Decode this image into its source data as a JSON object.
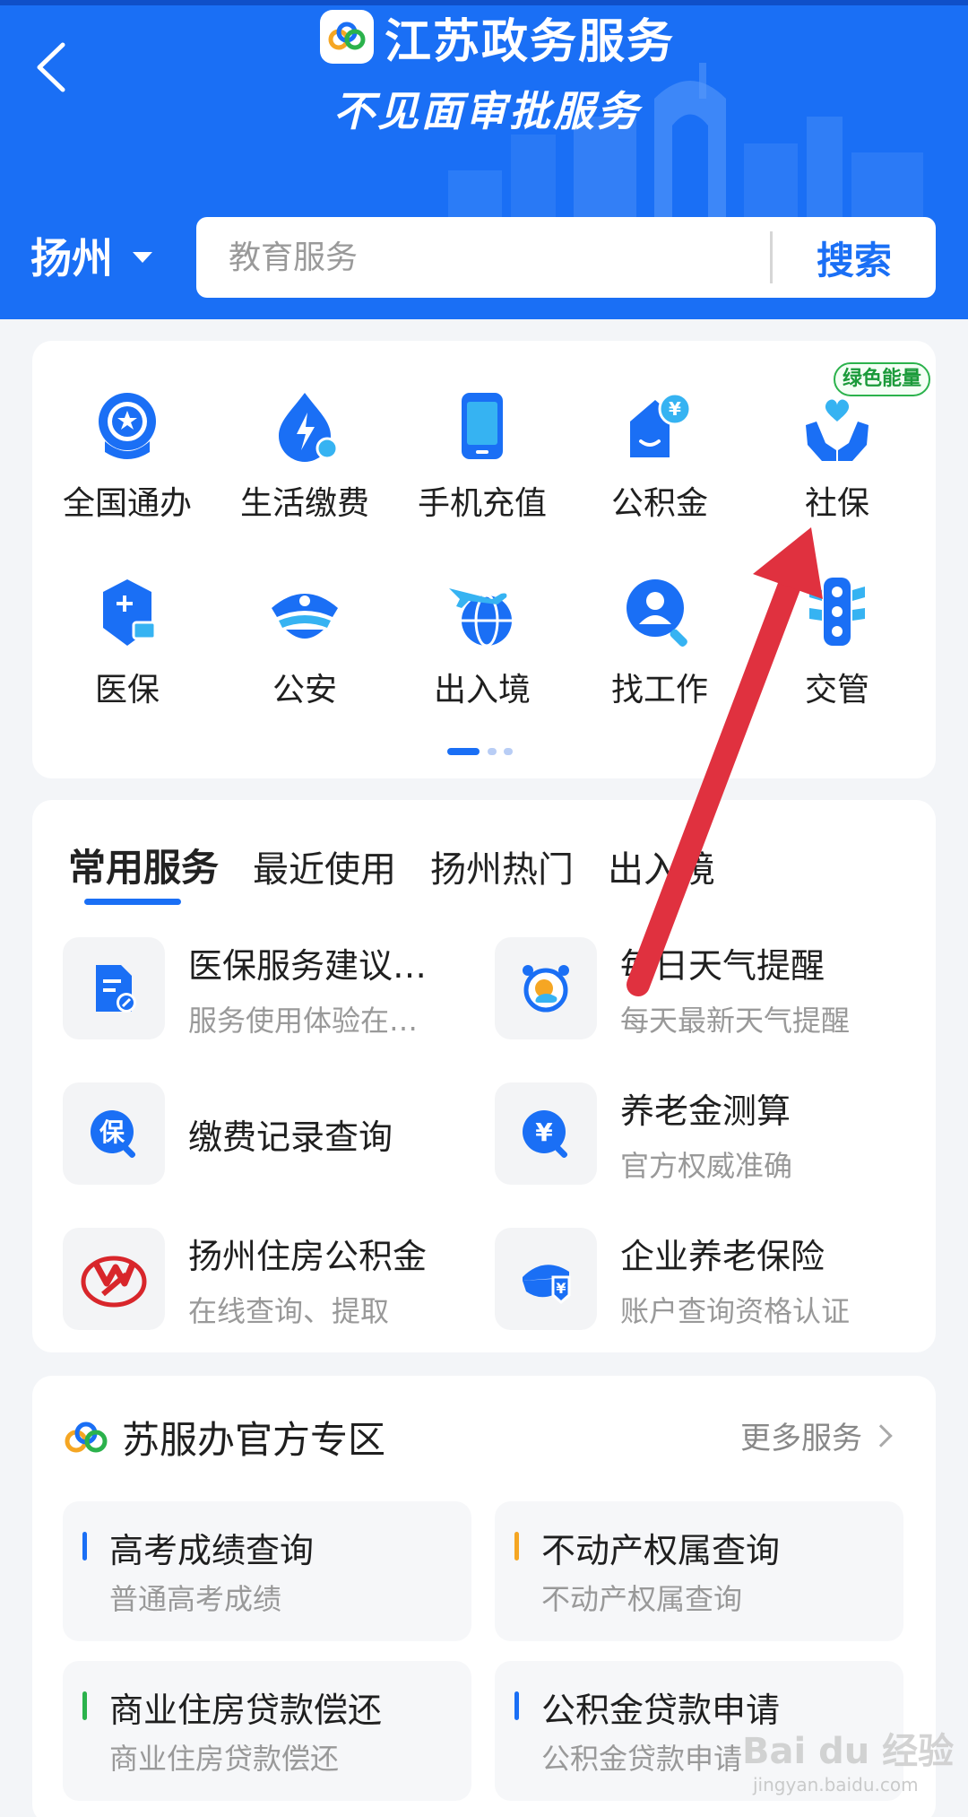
{
  "header": {
    "brand_title": "江苏政务服务",
    "subtitle": "不见面审批服务",
    "city": "扬州",
    "search_placeholder": "教育服务",
    "search_button": "搜索"
  },
  "quick_grid": {
    "items": [
      {
        "label": "全国通办",
        "icon": "national-service-icon"
      },
      {
        "label": "生活缴费",
        "icon": "utility-payment-icon"
      },
      {
        "label": "手机充值",
        "icon": "phone-recharge-icon"
      },
      {
        "label": "公积金",
        "icon": "housing-fund-icon"
      },
      {
        "label": "社保",
        "icon": "social-security-icon"
      },
      {
        "label": "医保",
        "icon": "medical-insurance-icon"
      },
      {
        "label": "公安",
        "icon": "police-icon"
      },
      {
        "label": "出入境",
        "icon": "immigration-icon"
      },
      {
        "label": "找工作",
        "icon": "job-search-icon"
      },
      {
        "label": "交管",
        "icon": "traffic-icon"
      }
    ],
    "badge": "绿色能量",
    "page_count": 3,
    "current_page": 1
  },
  "services": {
    "tabs": [
      "常用服务",
      "最近使用",
      "扬州热门",
      "出入境"
    ],
    "active_tab": 0,
    "items": [
      {
        "title": "医保服务建议…",
        "sub": "服务使用体验在…",
        "icon": "document-edit-icon"
      },
      {
        "title": "每日天气提醒",
        "sub": "每天最新天气提醒",
        "icon": "weather-alarm-icon"
      },
      {
        "title": "缴费记录查询",
        "sub": "",
        "icon": "insurance-search-icon"
      },
      {
        "title": "养老金测算",
        "sub": "官方权威准确",
        "icon": "pension-search-icon"
      },
      {
        "title": "扬州住房公积金",
        "sub": "在线查询、提取",
        "icon": "yangzhou-fund-logo"
      },
      {
        "title": "企业养老保险",
        "sub": "账户查询资格认证",
        "icon": "enterprise-pension-icon"
      }
    ]
  },
  "official_zone": {
    "title": "苏服办官方专区",
    "more": "更多服务",
    "items": [
      {
        "title": "高考成绩查询",
        "sub": "普通高考成绩",
        "color": "#1a6ff5"
      },
      {
        "title": "不动产权属查询",
        "sub": "不动产权属查询",
        "color": "#f5a623"
      },
      {
        "title": "商业住房贷款偿还",
        "sub": "商业住房贷款偿还",
        "color": "#2bb24c"
      },
      {
        "title": "公积金贷款申请",
        "sub": "公积金贷款申请",
        "color": "#1a6ff5"
      }
    ]
  },
  "watermark": {
    "text": "Bai du 经验",
    "url": "jingyan.baidu.com"
  },
  "colors": {
    "primary": "#1a6ff5",
    "annotation_arrow": "#e0313f"
  }
}
